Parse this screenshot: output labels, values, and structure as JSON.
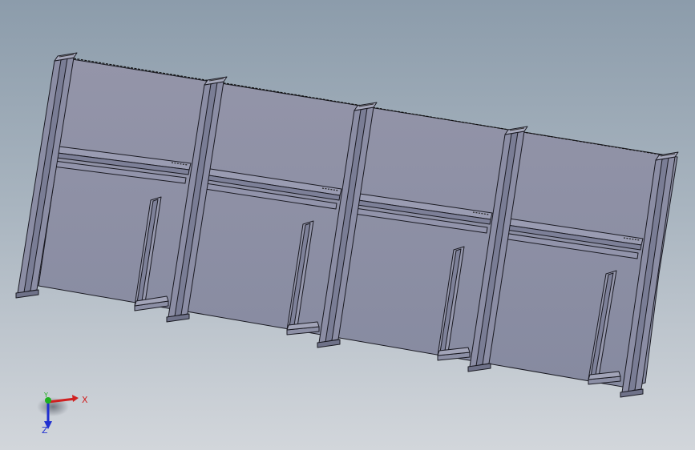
{
  "viewport": {
    "background_top": "#8c9cab",
    "background_bottom": "#d2d6db",
    "model": {
      "bays": 4,
      "columns": 5,
      "face_color": "#8b8ea4",
      "edge_color": "#1a1a22"
    }
  },
  "triad": {
    "x_label": "X",
    "y_label": "Y",
    "z_label": "Z",
    "x_color": "#d02020",
    "y_color": "#20b020",
    "z_color": "#2030d0"
  }
}
